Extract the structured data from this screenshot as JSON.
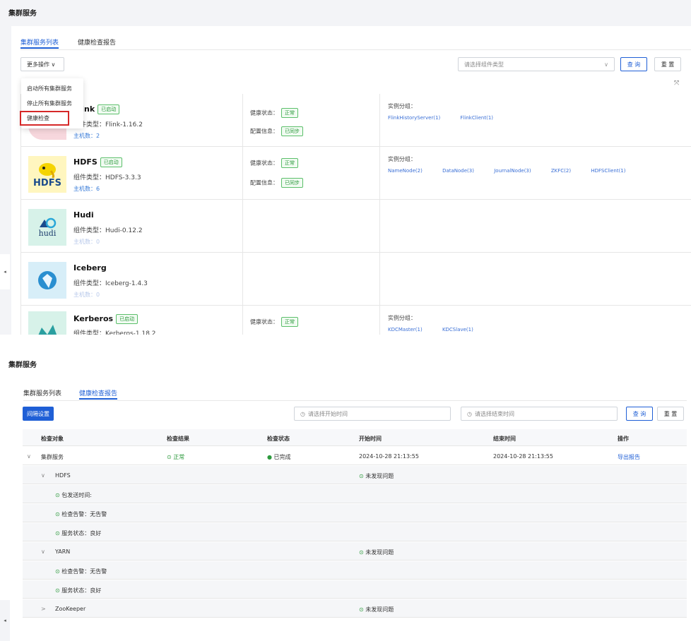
{
  "top": {
    "title": "集群服务",
    "tabs": [
      "集群服务列表",
      "健康检查报告"
    ],
    "more_ops": "更多操作 ∨",
    "select_placeholder": "请选择组件类型",
    "query": "查 询",
    "reset": "重 置",
    "menu": [
      "启动所有集群服务",
      "停止所有集群服务",
      "健康检查"
    ],
    "services": [
      {
        "name": "Flink",
        "tag": "已启动",
        "type": "组件类型：Flink-1.16.2",
        "hosts": "主机数：2",
        "health_label": "健康状态：",
        "health": "正常",
        "config_label": "配置信息：",
        "config": "已同步",
        "inst_title": "实例分组：",
        "instances": [
          "FlinkHistoryServer(1)",
          "FlinkClient(1)"
        ]
      },
      {
        "name": "HDFS",
        "tag": "已启动",
        "type": "组件类型：HDFS-3.3.3",
        "hosts": "主机数：6",
        "health_label": "健康状态：",
        "health": "正常",
        "config_label": "配置信息：",
        "config": "已同步",
        "inst_title": "实例分组：",
        "instances": [
          "NameNode(2)",
          "DataNode(3)",
          "JournalNode(3)",
          "ZKFC(2)",
          "HDFSClient(1)"
        ]
      },
      {
        "name": "Hudi",
        "type": "组件类型：Hudi-0.12.2",
        "hosts": "主机数：0"
      },
      {
        "name": "Iceberg",
        "type": "组件类型：Iceberg-1.4.3",
        "hosts": "主机数：0"
      },
      {
        "name": "Kerberos",
        "tag": "已启动",
        "type": "组件类型：Kerberos-1.18.2",
        "health_label": "健康状态：",
        "health": "正常",
        "inst_title": "实例分组：",
        "instances": [
          "KDCMaster(1)",
          "KDCSlave(1)"
        ]
      }
    ],
    "logo_hdfs": "HDFS",
    "logo_hudi": "hudi"
  },
  "bottom": {
    "title": "集群服务",
    "tabs": [
      "集群服务列表",
      "健康检查报告"
    ],
    "interval_btn": "间隔设置",
    "start_placeholder": "请选择开始时间",
    "end_placeholder": "请选择结束时间",
    "query": "查 询",
    "reset": "重 置",
    "columns": [
      "检查对象",
      "检查结果",
      "检查状态",
      "开始时间",
      "结束时间",
      "操作"
    ],
    "rows": [
      {
        "obj": "集群服务",
        "result": "正常",
        "status": "已完成",
        "start": "2024-10-28 21:13:55",
        "end": "2024-10-28 21:13:55",
        "op": "导出报告"
      },
      {
        "obj": "HDFS",
        "start_col": "未发现问题"
      },
      {
        "obj": "包发送时间:"
      },
      {
        "obj": "检查告警：无告警"
      },
      {
        "obj": "服务状态：良好"
      },
      {
        "obj": "YARN",
        "start_col": "未发现问题"
      },
      {
        "obj": "检查告警：无告警"
      },
      {
        "obj": "服务状态：良好"
      },
      {
        "obj": "ZooKeeper",
        "start_col": "未发现问题"
      }
    ]
  }
}
